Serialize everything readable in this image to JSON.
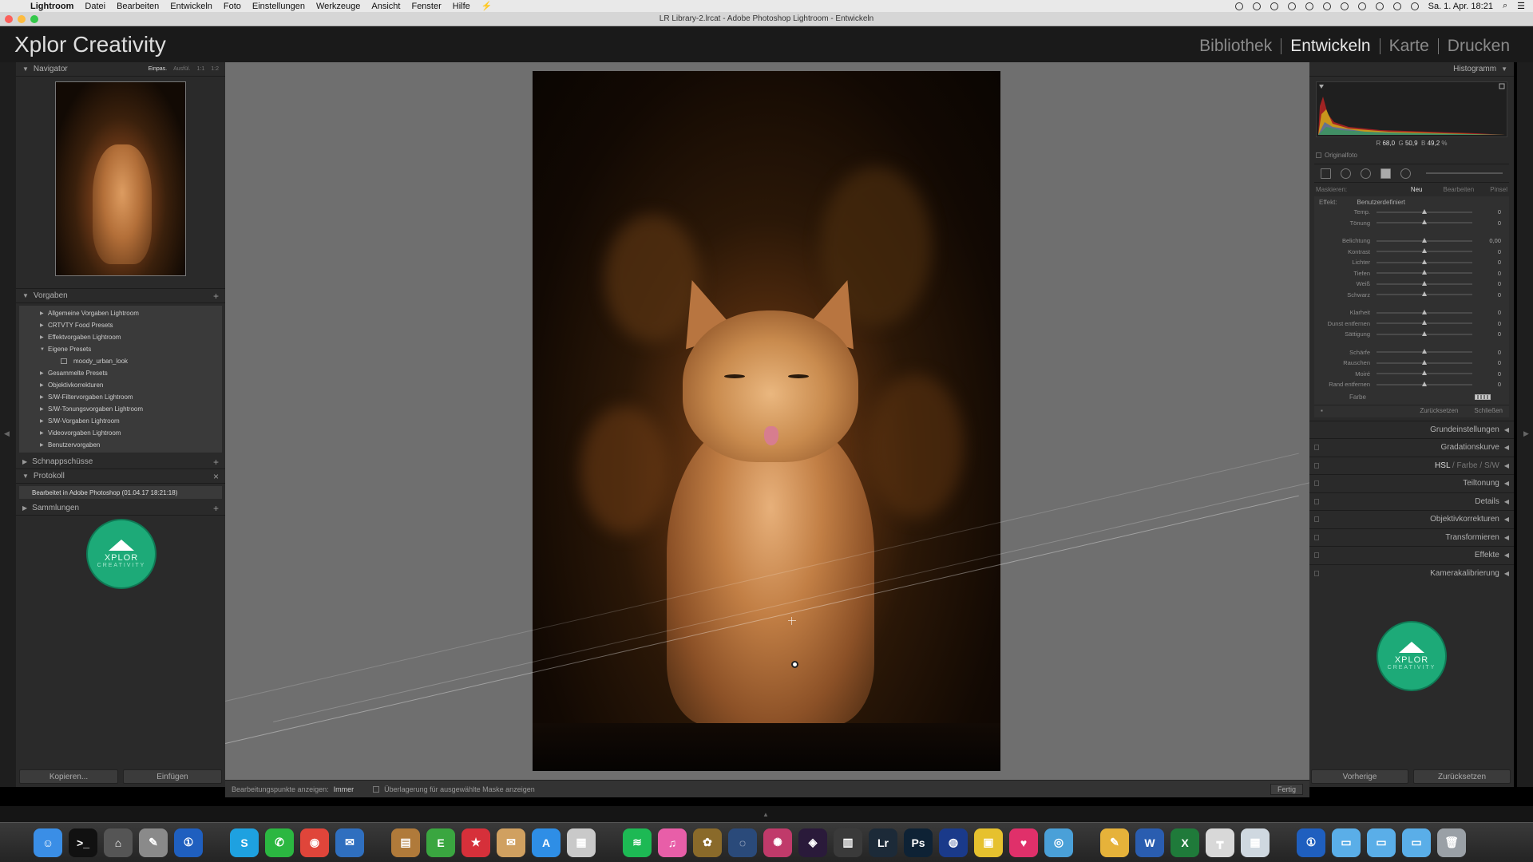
{
  "menubar": {
    "items": [
      "Lightroom",
      "Datei",
      "Bearbeiten",
      "Entwickeln",
      "Foto",
      "Einstellungen",
      "Werkzeuge",
      "Ansicht",
      "Fenster",
      "Hilfe"
    ],
    "clock": "Sa. 1. Apr. 18:21"
  },
  "window": {
    "title": "LR Library-2.lrcat - Adobe Photoshop Lightroom - Entwickeln"
  },
  "lr": {
    "identity": "Xplor Creativity",
    "modules": [
      "Bibliothek",
      "Entwickeln",
      "Karte",
      "Drucken"
    ],
    "active_module": "Entwickeln"
  },
  "left": {
    "navigator": {
      "title": "Navigator",
      "zoom_options": [
        "Einpas.",
        "Ausfül.",
        "1:1",
        "1:2"
      ]
    },
    "presets": {
      "title": "Vorgaben",
      "items": [
        {
          "label": "Allgemeine Vorgaben Lightroom",
          "expanded": false
        },
        {
          "label": "CRTVTY Food Presets",
          "expanded": false
        },
        {
          "label": "Effektvorgaben Lightroom",
          "expanded": false
        },
        {
          "label": "Eigene Presets",
          "expanded": true
        },
        {
          "label": "moody_urban_look",
          "child": true
        },
        {
          "label": "Gesammelte Presets",
          "expanded": false
        },
        {
          "label": "Objektivkorrekturen",
          "expanded": false
        },
        {
          "label": "S/W-Filtervorgaben Lightroom",
          "expanded": false
        },
        {
          "label": "S/W-Tonungsvorgaben Lightroom",
          "expanded": false
        },
        {
          "label": "S/W-Vorgaben Lightroom",
          "expanded": false
        },
        {
          "label": "Videovorgaben Lightroom",
          "expanded": false
        },
        {
          "label": "Benutzervorgaben",
          "expanded": false
        }
      ]
    },
    "snapshots": {
      "title": "Schnappschüsse"
    },
    "history": {
      "title": "Protokoll",
      "entry": "Bearbeitet in Adobe Photoshop (01.04.17 18:21:18)"
    },
    "collections": {
      "title": "Sammlungen"
    },
    "logo": {
      "text": "XPLOR",
      "sub": "CREATIVITY"
    },
    "copy_button": "Kopieren...",
    "paste_button": "Einfügen"
  },
  "toolbar": {
    "edit_points_label": "Bearbeitungspunkte anzeigen:",
    "edit_points_value": "Immer",
    "overlay_label": "Überlagerung für ausgewählte Maske anzeigen",
    "done_button": "Fertig"
  },
  "right": {
    "histogram": {
      "title": "Histogramm",
      "r_label": "R",
      "r": "68,0",
      "g_label": "G",
      "g": "50,9",
      "b_label": "B",
      "b": "49,2",
      "unit": "%"
    },
    "original_photo": "Originalfoto",
    "mask": {
      "label": "Maskieren:",
      "new": "Neu",
      "edit": "Bearbeiten",
      "brush": "Pinsel"
    },
    "effect": {
      "label": "Effekt:",
      "value": "Benutzerdefiniert"
    },
    "sliders": [
      {
        "label": "Temp.",
        "value": "0",
        "group": 1
      },
      {
        "label": "Tönung",
        "value": "0",
        "group": 1
      },
      {
        "label": "Belichtung",
        "value": "0,00",
        "group": 2
      },
      {
        "label": "Kontrast",
        "value": "0",
        "group": 2
      },
      {
        "label": "Lichter",
        "value": "0",
        "group": 2
      },
      {
        "label": "Tiefen",
        "value": "0",
        "group": 2
      },
      {
        "label": "Weiß",
        "value": "0",
        "group": 2
      },
      {
        "label": "Schwarz",
        "value": "0",
        "group": 2
      },
      {
        "label": "Klarheit",
        "value": "0",
        "group": 3
      },
      {
        "label": "Dunst entfernen",
        "value": "0",
        "group": 3
      },
      {
        "label": "Sättigung",
        "value": "0",
        "group": 3
      },
      {
        "label": "Schärfe",
        "value": "0",
        "group": 4
      },
      {
        "label": "Rauschen",
        "value": "0",
        "group": 4
      },
      {
        "label": "Moiré",
        "value": "0",
        "group": 4
      },
      {
        "label": "Rand entfernen",
        "value": "0",
        "group": 4
      }
    ],
    "color_label": "Farbe",
    "reset": "Zurücksetzen",
    "close": "Schließen",
    "sections": [
      "Grundeinstellungen",
      "Gradationskurve",
      "HSL / Farbe / S/W",
      "Teiltonung",
      "Details",
      "Objektivkorrekturen",
      "Transformieren",
      "Effekte",
      "Kamerakalibrierung"
    ],
    "hsl_parts": [
      "HSL",
      "Farbe",
      "S/W"
    ],
    "previous_button": "Vorherige",
    "reset_button": "Zurücksetzen"
  },
  "dock": {
    "apps": [
      {
        "name": "finder",
        "color": "#3a8ee6",
        "glyph": "☺"
      },
      {
        "name": "terminal",
        "color": "#111111",
        "glyph": ">_"
      },
      {
        "name": "launchpad",
        "color": "#555555",
        "glyph": "⌂"
      },
      {
        "name": "scripts",
        "color": "#8a8a8a",
        "glyph": "✎"
      },
      {
        "name": "1password",
        "color": "#1f5fbf",
        "glyph": "①"
      },
      {
        "name": "gap"
      },
      {
        "name": "skype",
        "color": "#1ea1e0",
        "glyph": "S"
      },
      {
        "name": "whatsapp",
        "color": "#2bb741",
        "glyph": "✆"
      },
      {
        "name": "chrome",
        "color": "#e0453a",
        "glyph": "◉"
      },
      {
        "name": "thunderbird",
        "color": "#2f6fbf",
        "glyph": "✉"
      },
      {
        "name": "gap"
      },
      {
        "name": "notefile",
        "color": "#b07a3a",
        "glyph": "▤"
      },
      {
        "name": "evernote",
        "color": "#3aa640",
        "glyph": "E"
      },
      {
        "name": "wunderlist",
        "color": "#d6303a",
        "glyph": "★"
      },
      {
        "name": "mail-stack",
        "color": "#d0a060",
        "glyph": "✉"
      },
      {
        "name": "app-store",
        "color": "#2e8ee6",
        "glyph": "A"
      },
      {
        "name": "preview",
        "color": "#c9c9c9",
        "glyph": "▦"
      },
      {
        "name": "gap"
      },
      {
        "name": "spotify",
        "color": "#1db954",
        "glyph": "≋"
      },
      {
        "name": "itunes",
        "color": "#e85ea8",
        "glyph": "♫"
      },
      {
        "name": "cocktail",
        "color": "#8a6a2a",
        "glyph": "✿"
      },
      {
        "name": "quicktime",
        "color": "#2a4a7a",
        "glyph": "◌"
      },
      {
        "name": "davinci",
        "color": "#c03a6a",
        "glyph": "✺"
      },
      {
        "name": "premiere",
        "color": "#2a1a3a",
        "glyph": "◈"
      },
      {
        "name": "photoshop-mix",
        "color": "#3a3a3a",
        "glyph": "▥"
      },
      {
        "name": "lightroom",
        "color": "#1c2a38",
        "glyph": "Lr"
      },
      {
        "name": "photoshop",
        "color": "#0e2235",
        "glyph": "Ps"
      },
      {
        "name": "globe",
        "color": "#1a3a8a",
        "glyph": "◍"
      },
      {
        "name": "colorsync",
        "color": "#e6c12e",
        "glyph": "▣"
      },
      {
        "name": "kiss-app",
        "color": "#e0306a",
        "glyph": "♥"
      },
      {
        "name": "screenshot",
        "color": "#4aa0d8",
        "glyph": "◎"
      },
      {
        "name": "gap"
      },
      {
        "name": "text-edit",
        "color": "#e6b23a",
        "glyph": "✎"
      },
      {
        "name": "word",
        "color": "#2a5db0",
        "glyph": "W"
      },
      {
        "name": "excel",
        "color": "#1f7a3a",
        "glyph": "X"
      },
      {
        "name": "keynote",
        "color": "#d8d8d8",
        "glyph": "┳"
      },
      {
        "name": "archive",
        "color": "#cfd8e0",
        "glyph": "▦"
      },
      {
        "name": "gap"
      },
      {
        "name": "1password-2",
        "color": "#1f5fbf",
        "glyph": "①"
      },
      {
        "name": "folder-1",
        "color": "#5aaee8",
        "glyph": "▭"
      },
      {
        "name": "folder-2",
        "color": "#5aaee8",
        "glyph": "▭"
      },
      {
        "name": "folder-3",
        "color": "#5aaee8",
        "glyph": "▭"
      },
      {
        "name": "trash",
        "color": "#9aa0a6",
        "glyph": "🗑"
      }
    ]
  },
  "colors": {
    "accent_logo": "#1daa78",
    "panel_bg": "#2a2a2a",
    "canvas_bg": "#6f6f6f"
  }
}
